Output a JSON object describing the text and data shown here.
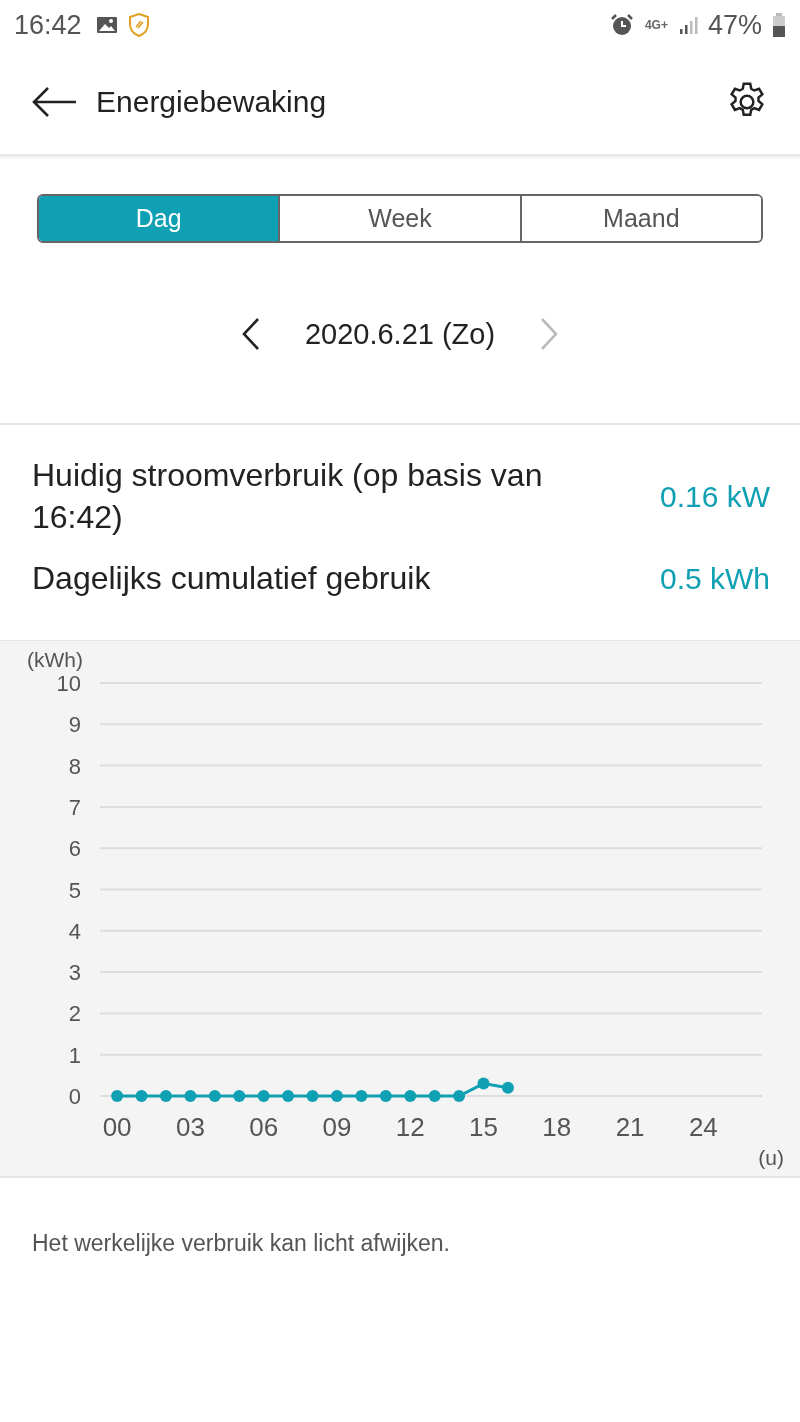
{
  "status_bar": {
    "time": "16:42",
    "network": "4G+",
    "battery": "47%"
  },
  "app_bar": {
    "title": "Energiebewaking"
  },
  "tabs": [
    {
      "label": "Dag",
      "selected": true
    },
    {
      "label": "Week",
      "selected": false
    },
    {
      "label": "Maand",
      "selected": false
    }
  ],
  "date_nav": {
    "date": "2020.6.21 (Zo)",
    "next_disabled": true
  },
  "stats": [
    {
      "label": "Huidig stroomverbruik (op basis van 16:42)",
      "value": "0.16 kW"
    },
    {
      "label": "Dagelijks cumulatief gebruik",
      "value": "0.5 kWh"
    }
  ],
  "chart": {
    "chart_data": {
      "type": "line",
      "ylabel": "(kWh)",
      "xlabel": "(u)",
      "x": [
        0,
        1,
        2,
        3,
        4,
        5,
        6,
        7,
        8,
        9,
        10,
        11,
        12,
        13,
        14,
        15,
        16
      ],
      "series": [
        {
          "color": "#0fa0b4",
          "marker": "circle",
          "values": [
            0,
            0,
            0,
            0,
            0,
            0,
            0,
            0,
            0,
            0,
            0,
            0,
            0,
            0,
            0,
            0.3,
            0.2
          ]
        }
      ],
      "xlim": [
        -0.7,
        26.4
      ],
      "ylim": [
        0,
        10
      ],
      "grid": true,
      "xticks": [
        {
          "value": 0,
          "label": "00"
        },
        {
          "value": 3,
          "label": "03"
        },
        {
          "value": 6,
          "label": "06"
        },
        {
          "value": 9,
          "label": "09"
        },
        {
          "value": 12,
          "label": "12"
        },
        {
          "value": 15,
          "label": "15"
        },
        {
          "value": 18,
          "label": "18"
        },
        {
          "value": 21,
          "label": "21"
        },
        {
          "value": 24,
          "label": "24"
        }
      ],
      "yticks": [
        0,
        1,
        2,
        3,
        4,
        5,
        6,
        7,
        8,
        9,
        10
      ]
    }
  },
  "footnote": "Het werkelijke verbruik kan licht afwijken."
}
